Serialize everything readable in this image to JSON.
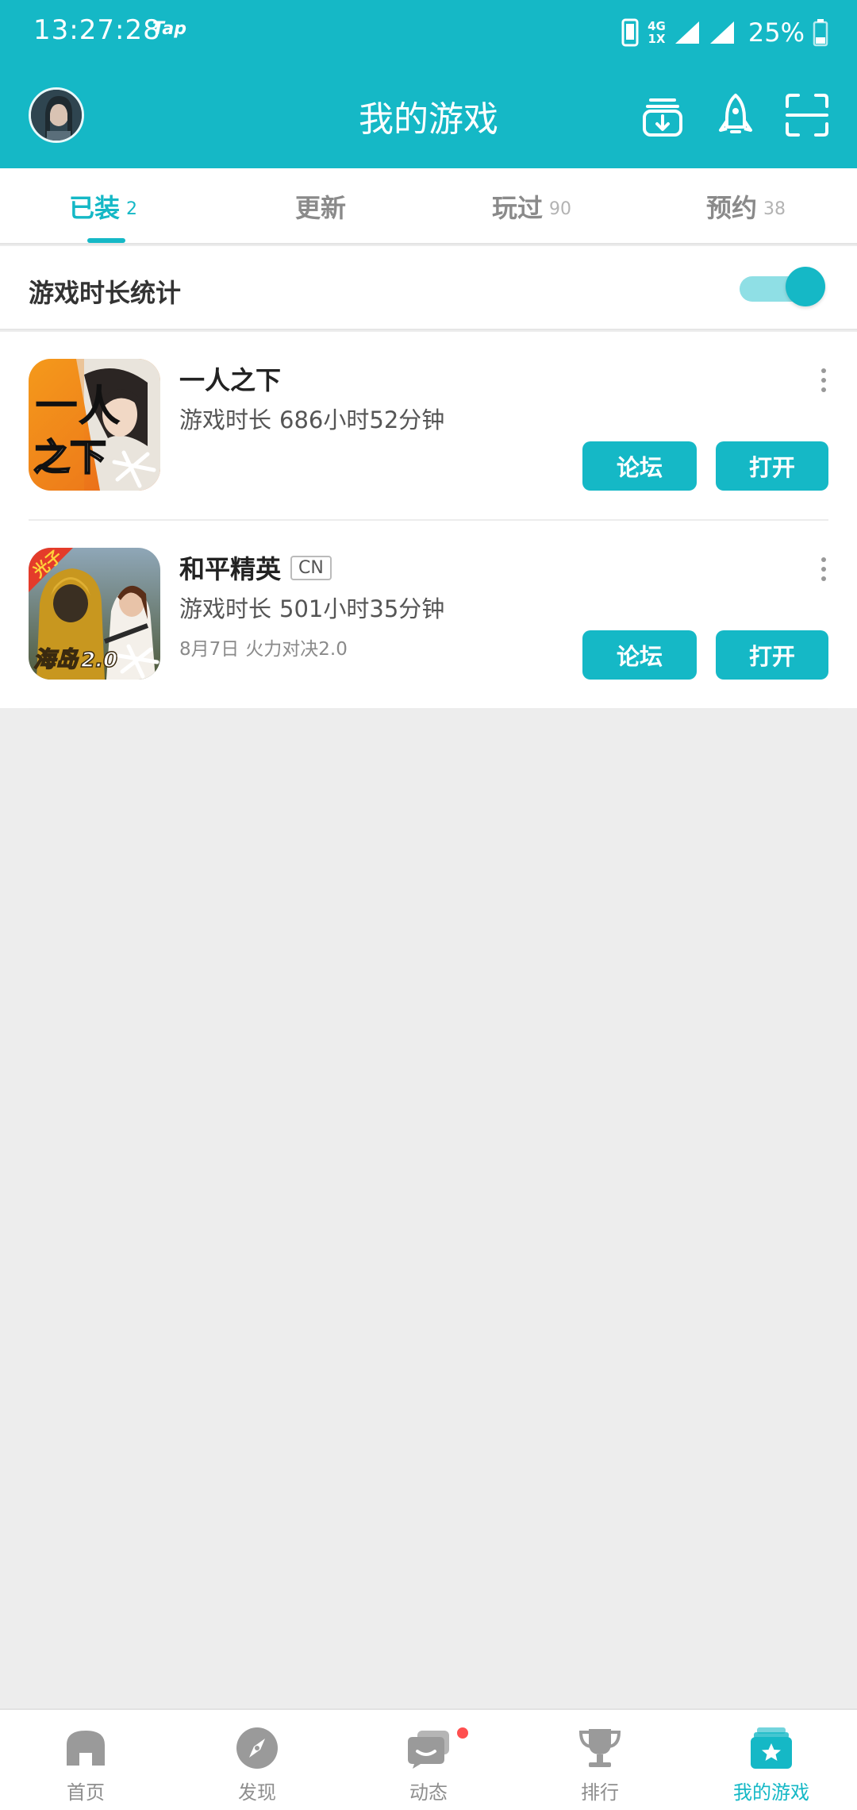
{
  "status_bar": {
    "time": "13:27:28",
    "app_tag": "Tap",
    "network_top": "4G",
    "network_bottom": "1X",
    "battery": "25%"
  },
  "header": {
    "title": "我的游戏",
    "icons": [
      "avatar",
      "download-manager-icon",
      "rocket-icon",
      "scan-icon"
    ]
  },
  "tabs": [
    {
      "label": "已装",
      "count": "2",
      "active": true
    },
    {
      "label": "更新",
      "count": "",
      "active": false
    },
    {
      "label": "玩过",
      "count": "90",
      "active": false
    },
    {
      "label": "预约",
      "count": "38",
      "active": false
    }
  ],
  "stats": {
    "label": "游戏时长统计",
    "enabled": true
  },
  "games": [
    {
      "name": "一人之下",
      "region": "",
      "time_label": "游戏时长",
      "time_value": "686小时52分钟",
      "note_date": "",
      "note_text": "",
      "forum_label": "论坛",
      "open_label": "打开"
    },
    {
      "name": "和平精英",
      "region": "CN",
      "time_label": "游戏时长",
      "time_value": "501小时35分钟",
      "note_date": "8月7日",
      "note_text": "火力对决2.0",
      "forum_label": "论坛",
      "open_label": "打开"
    }
  ],
  "game_icon_text": {
    "g1_a": "一人",
    "g1_b": "之下",
    "g2_a": "光子",
    "g2_b": "海岛",
    "g2_c": "2.0"
  },
  "bottom_nav": [
    {
      "label": "首页",
      "icon": "home-icon",
      "active": false
    },
    {
      "label": "发现",
      "icon": "compass-icon",
      "active": false
    },
    {
      "label": "动态",
      "icon": "chat-icon",
      "active": false,
      "badge": true
    },
    {
      "label": "排行",
      "icon": "trophy-icon",
      "active": false
    },
    {
      "label": "我的游戏",
      "icon": "my-games-icon",
      "active": true
    }
  ],
  "colors": {
    "accent": "#15b8c6",
    "background": "#ededed",
    "badge": "#ff4f4f"
  }
}
